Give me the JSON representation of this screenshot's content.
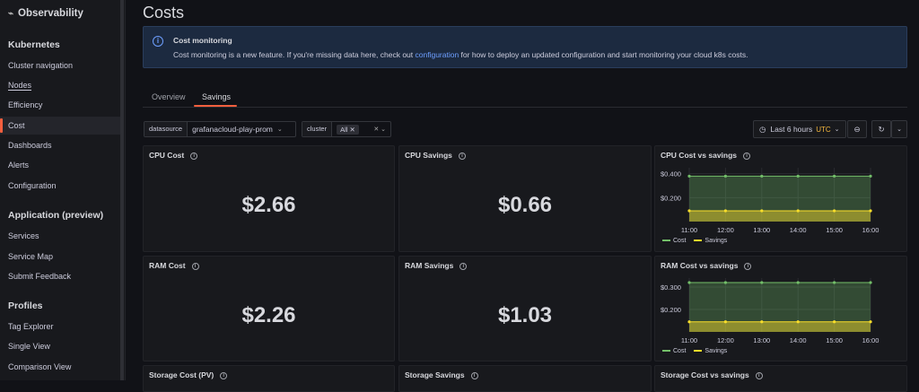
{
  "sidebar": {
    "brand": "Observability",
    "sections": [
      {
        "title": "Kubernetes",
        "items": [
          "Cluster navigation",
          "Nodes",
          "Efficiency",
          "Cost",
          "Dashboards",
          "Alerts",
          "Configuration"
        ]
      },
      {
        "title": "Application (preview)",
        "items": [
          "Services",
          "Service Map",
          "Submit Feedback"
        ]
      },
      {
        "title": "Profiles",
        "items": [
          "Tag Explorer",
          "Single View",
          "Comparison View"
        ]
      }
    ],
    "active_item": "Cost"
  },
  "page": {
    "title": "Costs"
  },
  "info": {
    "title": "Cost monitoring",
    "text_before": "Cost monitoring is a new feature. If you're missing data here, check out ",
    "link": "configuration",
    "text_after": " for how to deploy an updated configuration and start monitoring your cloud k8s costs."
  },
  "tabs": {
    "overview": "Overview",
    "savings": "Savings",
    "active": "Savings"
  },
  "vars": {
    "datasource_label": "datasource",
    "datasource_value": "grafanacloud-play-prom",
    "cluster_label": "cluster",
    "cluster_value": "All"
  },
  "time": {
    "range": "Last 6 hours",
    "tz": "UTC"
  },
  "panels": {
    "cpu_cost": {
      "title": "CPU Cost",
      "value": "$2.66"
    },
    "cpu_savings": {
      "title": "CPU Savings",
      "value": "$0.66"
    },
    "cpu_chart": {
      "title": "CPU Cost vs savings"
    },
    "ram_cost": {
      "title": "RAM Cost",
      "value": "$2.26"
    },
    "ram_savings": {
      "title": "RAM Savings",
      "value": "$1.03"
    },
    "ram_chart": {
      "title": "RAM Cost vs savings"
    },
    "storage_cost": {
      "title": "Storage Cost (PV)"
    },
    "storage_savings": {
      "title": "Storage Savings"
    },
    "storage_chart": {
      "title": "Storage Cost vs savings"
    }
  },
  "colors": {
    "cost": "#73bf69",
    "savings": "#fade2a",
    "accent": "#f55f3e",
    "link": "#6e9fff"
  },
  "chart_data": [
    {
      "type": "line",
      "title": "CPU Cost vs savings",
      "x": [
        "11:00",
        "12:00",
        "13:00",
        "14:00",
        "15:00",
        "16:00"
      ],
      "yticks": [
        "$0.200",
        "$0.400"
      ],
      "ylim": [
        0,
        0.45
      ],
      "series": [
        {
          "name": "Cost",
          "values": [
            0.38,
            0.38,
            0.38,
            0.38,
            0.38,
            0.38
          ]
        },
        {
          "name": "Savings",
          "values": [
            0.09,
            0.09,
            0.09,
            0.09,
            0.09,
            0.09
          ]
        }
      ]
    },
    {
      "type": "line",
      "title": "RAM Cost vs savings",
      "x": [
        "11:00",
        "12:00",
        "13:00",
        "14:00",
        "15:00",
        "16:00"
      ],
      "yticks": [
        "$0.200",
        "$0.300"
      ],
      "ylim": [
        0.1,
        0.34
      ],
      "series": [
        {
          "name": "Cost",
          "values": [
            0.32,
            0.32,
            0.32,
            0.32,
            0.32,
            0.32
          ]
        },
        {
          "name": "Savings",
          "values": [
            0.145,
            0.145,
            0.145,
            0.145,
            0.145,
            0.145
          ]
        }
      ]
    }
  ]
}
